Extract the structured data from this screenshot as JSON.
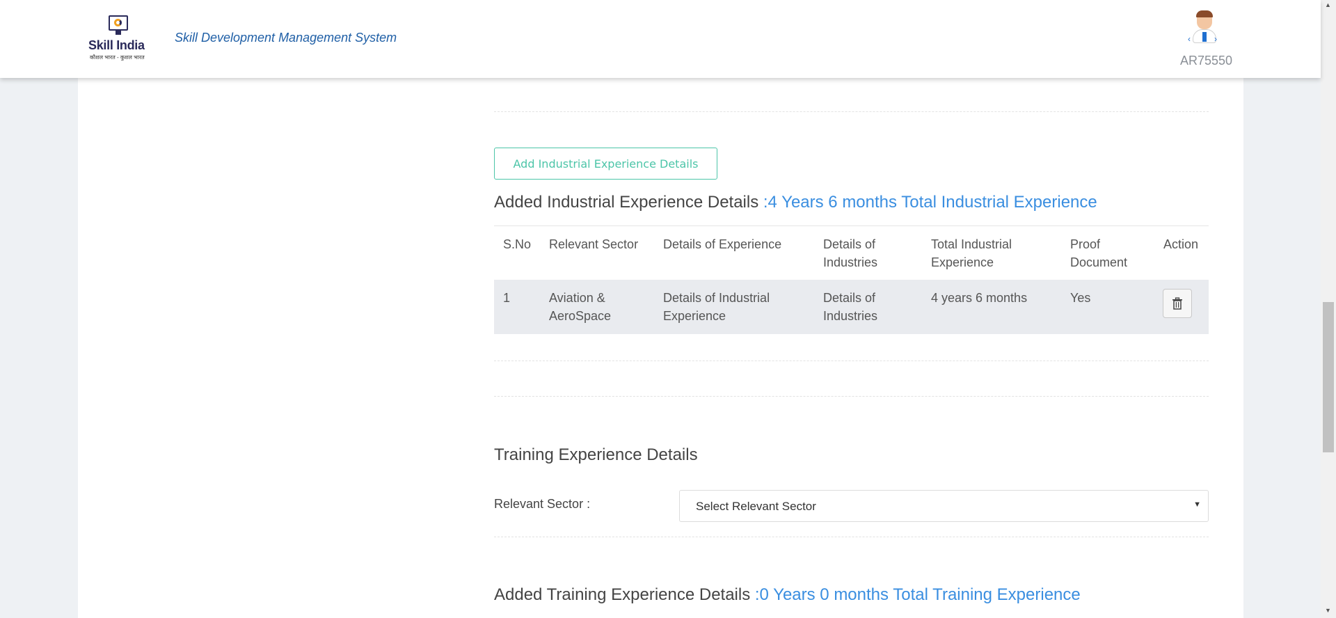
{
  "header": {
    "logo_text": "Skill India",
    "logo_sub": "कौशल भारत - कुशल भारत",
    "app_title": "Skill Development Management System",
    "user_id": "AR75550"
  },
  "industrial": {
    "add_button": "Add Industrial Experience Details",
    "title": "Added Industrial Experience Details ",
    "total": ":4 Years 6 months Total Industrial Experience",
    "columns": [
      "S.No",
      "Relevant Sector",
      "Details of Experience",
      "Details of Industries",
      "Total Industrial Experience",
      "Proof Document",
      "Action"
    ],
    "rows": [
      {
        "sno": "1",
        "sector": "Aviation & AeroSpace",
        "experience": "Details of Industrial Experience",
        "industries": "Details of Industries",
        "total": "4 years 6 months",
        "proof": "Yes"
      }
    ]
  },
  "training": {
    "title": "Training Experience Details",
    "sector_label": "Relevant Sector :",
    "sector_value": "Select Relevant Sector",
    "added_title": "Added Training Experience Details ",
    "added_total": ":0 Years 0 months Total Training Experience"
  },
  "colors": {
    "accent": "#3a8ee0",
    "button_border": "#4cc5a8",
    "title_blue": "#1f5fa6"
  },
  "icons": [
    "trash-icon",
    "user-avatar-icon",
    "chevron-down-icon"
  ]
}
